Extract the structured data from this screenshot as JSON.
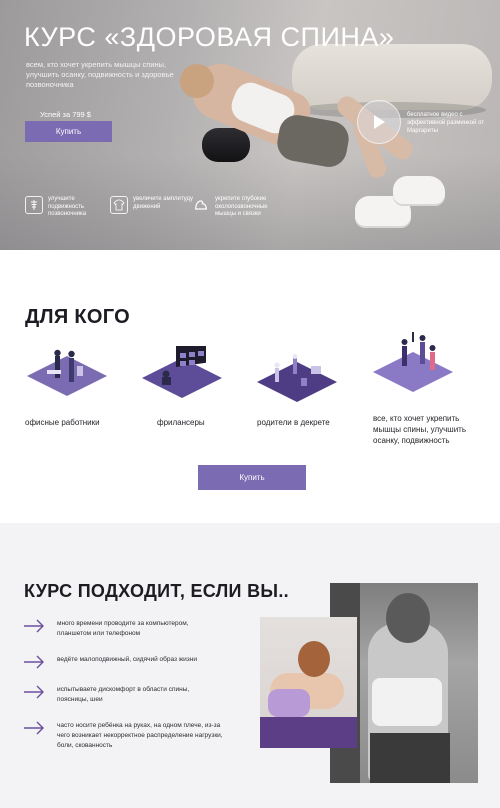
{
  "hero": {
    "title": "КУРС  «ЗДОРОВАЯ СПИНА»",
    "description": "всем, кто хочет укрепить мышцы спины, улучшить осанку, подвижность и здоровье позвоночника",
    "price": "Успей за 799 $",
    "buy_label": "Купить",
    "video_caption": "бесплатное видео с эффективной разминкой от Маргариты",
    "benefits": [
      {
        "icon": "spine-icon",
        "text": "улучшите подвижность позвоночника"
      },
      {
        "icon": "tshirt-icon",
        "text": "увеличите амплитуду движений"
      },
      {
        "icon": "muscle-icon",
        "text": "укрепите глубокие околопозвоночные мышцы и связки"
      }
    ]
  },
  "who": {
    "title": "ДЛЯ КОГО",
    "items": [
      {
        "label": "офисные работники",
        "color": "#7b6bb3"
      },
      {
        "label": "фрилансеры",
        "color": "#5d4d98"
      },
      {
        "label": "родители в декрете",
        "color": "#4e3c84"
      },
      {
        "label": "все, кто хочет укрепить мышцы спины, улучшить осанку, подвижность",
        "color": "#8a79c4"
      }
    ],
    "buy_label": "Купить"
  },
  "suitable": {
    "title": "КУРС ПОДХОДИТ, ЕСЛИ ВЫ..",
    "items": [
      "много времени проводите за компьютером, планшетом или телефоном",
      "ведёте малоподвижный, сидячий образ жизни",
      "испытываете дискомфорт в области спины, поясницы, шеи",
      "часто носите ребёнка на руках, на одном плече, из-за чего возникает некорректное распределение нагрузки, боли, скованность"
    ]
  },
  "colors": {
    "accent": "#7b6bb3",
    "arrow": "#6a4f9e"
  }
}
